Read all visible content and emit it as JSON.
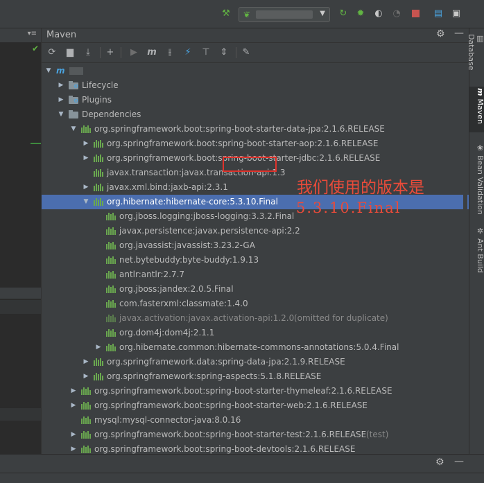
{
  "toolbar": {
    "run_config_label": "",
    "icons": [
      "hammer-icon",
      "run-icon",
      "debug-icon",
      "coverage-icon",
      "profile-icon",
      "stop-icon",
      "project-structure-icon",
      "layout-icon"
    ]
  },
  "maven": {
    "title": "Maven",
    "project_name": "",
    "tree": [
      {
        "label": "",
        "level": 0,
        "arrow": "down",
        "icon": "maven-module"
      },
      {
        "label": "Lifecycle",
        "level": 1,
        "arrow": "right",
        "icon": "folder-gear"
      },
      {
        "label": "Plugins",
        "level": 1,
        "arrow": "right",
        "icon": "folder-gear"
      },
      {
        "label": "Dependencies",
        "level": 1,
        "arrow": "down",
        "icon": "folder-lib"
      },
      {
        "label": "org.springframework.boot:spring-boot-starter-data-jpa:2.1.6.RELEASE",
        "level": 2,
        "arrow": "down",
        "icon": "lib"
      },
      {
        "label": "org.springframework.boot:spring-boot-starter-aop:2.1.6.RELEASE",
        "level": 3,
        "arrow": "right",
        "icon": "lib"
      },
      {
        "label": "org.springframework.boot:spring-boot-starter-jdbc:2.1.6.RELEASE",
        "level": 3,
        "arrow": "right",
        "icon": "lib"
      },
      {
        "label": "javax.transaction:javax.transaction-api:1.3",
        "level": 3,
        "arrow": "none",
        "icon": "lib"
      },
      {
        "label": "javax.xml.bind:jaxb-api:2.3.1",
        "level": 3,
        "arrow": "right",
        "icon": "lib"
      },
      {
        "label": "org.hibernate:hibernate-core:5.3.10.Final",
        "level": 3,
        "arrow": "down",
        "icon": "lib",
        "selected": true
      },
      {
        "label": "org.jboss.logging:jboss-logging:3.3.2.Final",
        "level": 4,
        "arrow": "none",
        "icon": "lib"
      },
      {
        "label": "javax.persistence:javax.persistence-api:2.2",
        "level": 4,
        "arrow": "none",
        "icon": "lib"
      },
      {
        "label": "org.javassist:javassist:3.23.2-GA",
        "level": 4,
        "arrow": "none",
        "icon": "lib"
      },
      {
        "label": "net.bytebuddy:byte-buddy:1.9.13",
        "level": 4,
        "arrow": "none",
        "icon": "lib"
      },
      {
        "label": "antlr:antlr:2.7.7",
        "level": 4,
        "arrow": "none",
        "icon": "lib"
      },
      {
        "label": "org.jboss:jandex:2.0.5.Final",
        "level": 4,
        "arrow": "none",
        "icon": "lib"
      },
      {
        "label": "com.fasterxml:classmate:1.4.0",
        "level": 4,
        "arrow": "none",
        "icon": "lib"
      },
      {
        "label": "javax.activation:javax.activation-api:1.2.0",
        "suffix": " (omitted for duplicate)",
        "level": 4,
        "arrow": "none",
        "icon": "lib",
        "dim": true
      },
      {
        "label": "org.dom4j:dom4j:2.1.1",
        "level": 4,
        "arrow": "none",
        "icon": "lib"
      },
      {
        "label": "org.hibernate.common:hibernate-commons-annotations:5.0.4.Final",
        "level": 4,
        "arrow": "right",
        "icon": "lib"
      },
      {
        "label": "org.springframework.data:spring-data-jpa:2.1.9.RELEASE",
        "level": 3,
        "arrow": "right",
        "icon": "lib"
      },
      {
        "label": "org.springframework:spring-aspects:5.1.8.RELEASE",
        "level": 3,
        "arrow": "right",
        "icon": "lib"
      },
      {
        "label": "org.springframework.boot:spring-boot-starter-thymeleaf:2.1.6.RELEASE",
        "level": 2,
        "arrow": "right",
        "icon": "lib"
      },
      {
        "label": "org.springframework.boot:spring-boot-starter-web:2.1.6.RELEASE",
        "level": 2,
        "arrow": "right",
        "icon": "lib"
      },
      {
        "label": "mysql:mysql-connector-java:8.0.16",
        "level": 2,
        "arrow": "none",
        "icon": "lib"
      },
      {
        "label": "org.springframework.boot:spring-boot-starter-test:2.1.6.RELEASE",
        "suffix": " (test)",
        "level": 2,
        "arrow": "right",
        "icon": "lib"
      },
      {
        "label": "org.springframework.boot:spring-boot-devtools:2.1.6.RELEASE",
        "level": 2,
        "arrow": "right",
        "icon": "lib"
      }
    ]
  },
  "annotation": {
    "line1": "我们使用的版本是",
    "line2": "5.3.10.Final",
    "highlight_color": "#e0322b"
  },
  "right_tabs": [
    "Database",
    "Maven",
    "Bean Validation",
    "Ant Build"
  ],
  "colors": {
    "selection": "#4b6eaf",
    "library_icon": "#6aa84f",
    "panel_bg": "#3c3f41",
    "editor_bg": "#2b2b2b"
  }
}
